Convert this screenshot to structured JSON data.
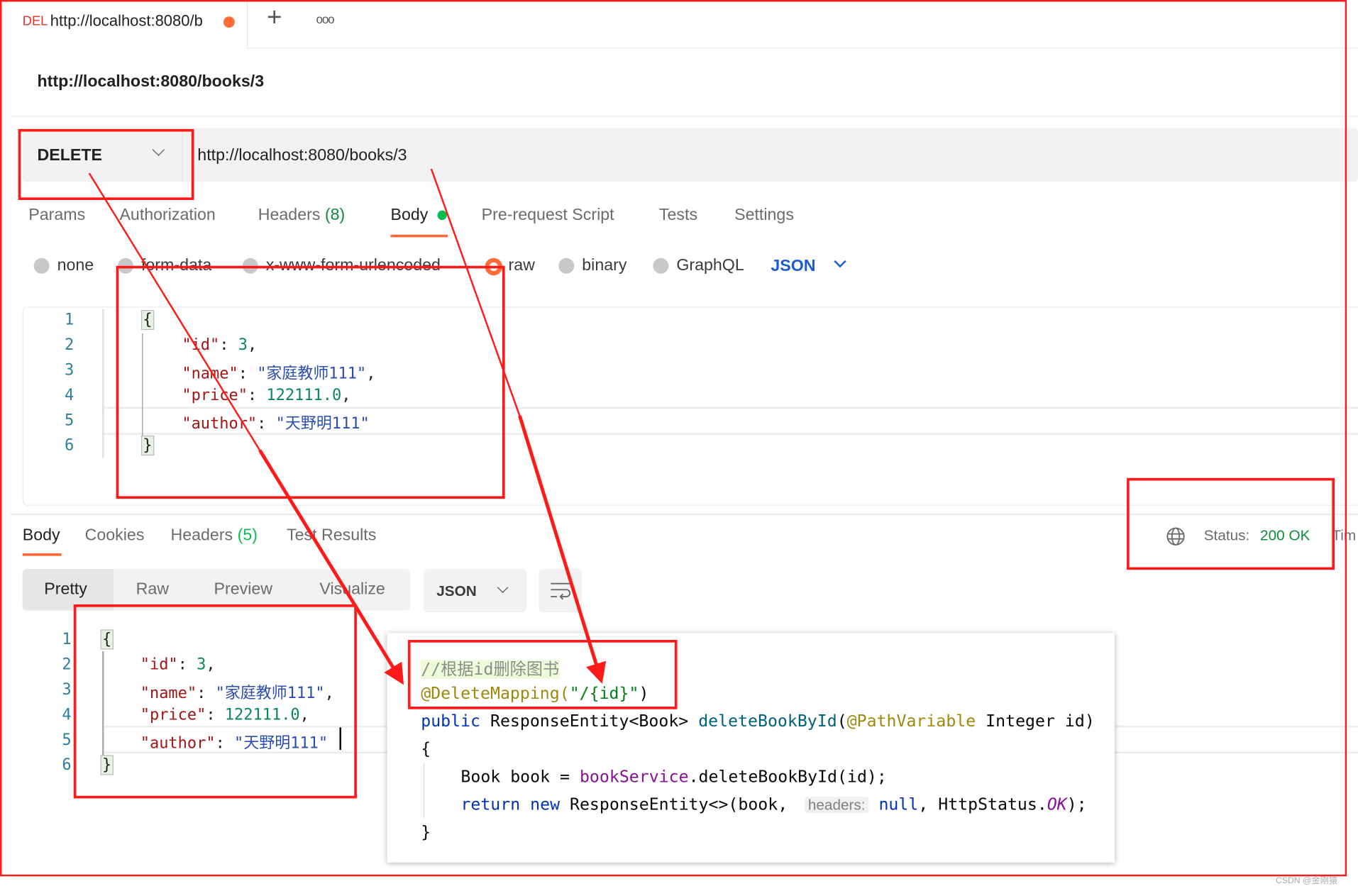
{
  "tab": {
    "method_badge": "DEL",
    "title": "http://localhost:8080/b",
    "unsaved_color": "#ff6c37",
    "new_tab": "+",
    "more": "ooo"
  },
  "request": {
    "name": "http://localhost:8080/books/3",
    "method": "DELETE",
    "url": "http://localhost:8080/books/3",
    "tabs": [
      {
        "label": "Params"
      },
      {
        "label": "Authorization"
      },
      {
        "label": "Headers",
        "count": "(8)"
      },
      {
        "label": "Body",
        "active": true
      },
      {
        "label": "Pre-request Script"
      },
      {
        "label": "Tests"
      },
      {
        "label": "Settings"
      }
    ],
    "body_types": [
      "none",
      "form-data",
      "x-www-form-urlencoded",
      "raw",
      "binary",
      "GraphQL"
    ],
    "selected_body_type": "raw",
    "format": "JSON",
    "body_lines": [
      {
        "num": "1",
        "tokens": [
          {
            "t": "{",
            "c": "p"
          }
        ]
      },
      {
        "num": "2",
        "tokens": [
          {
            "t": "\"id\"",
            "c": "k"
          },
          {
            "t": ": ",
            "c": "p"
          },
          {
            "t": "3",
            "c": "n"
          },
          {
            "t": ",",
            "c": "p"
          }
        ]
      },
      {
        "num": "3",
        "tokens": [
          {
            "t": "\"name\"",
            "c": "k"
          },
          {
            "t": ": ",
            "c": "p"
          },
          {
            "t": "\"家庭教师111\"",
            "c": "s"
          },
          {
            "t": ",",
            "c": "p"
          }
        ]
      },
      {
        "num": "4",
        "tokens": [
          {
            "t": "\"price\"",
            "c": "k"
          },
          {
            "t": ": ",
            "c": "p"
          },
          {
            "t": "122111.0",
            "c": "n"
          },
          {
            "t": ",",
            "c": "p"
          }
        ]
      },
      {
        "num": "5",
        "tokens": [
          {
            "t": "\"author\"",
            "c": "k"
          },
          {
            "t": ": ",
            "c": "p"
          },
          {
            "t": "\"天野明111\"",
            "c": "s"
          }
        ]
      },
      {
        "num": "6",
        "tokens": [
          {
            "t": "}",
            "c": "p"
          }
        ]
      }
    ]
  },
  "response": {
    "tabs": [
      {
        "label": "Body",
        "active": true
      },
      {
        "label": "Cookies"
      },
      {
        "label": "Headers",
        "count": "(5)"
      },
      {
        "label": "Test Results"
      }
    ],
    "status_label": "Status:",
    "status_value": "200 OK",
    "time_label": "Tim",
    "views": [
      "Pretty",
      "Raw",
      "Preview",
      "Visualize"
    ],
    "active_view": "Pretty",
    "format": "JSON"
  },
  "code_popup": {
    "lines": [
      [
        {
          "t": "//根据id删除图书",
          "c": "#8c8c8c",
          "bg": "#edfcd8"
        }
      ],
      [
        {
          "t": "@DeleteMapping(",
          "c": "#9e880d"
        },
        {
          "t": "\"/{id}\"",
          "c": "#067d17"
        },
        {
          "t": ")",
          "c": "#080808"
        }
      ],
      [
        {
          "t": "public ",
          "c": "#0033b3"
        },
        {
          "t": "ResponseEntity<Book> ",
          "c": "#080808"
        },
        {
          "t": "deleteBookById",
          "c": "#00627a"
        },
        {
          "t": "(",
          "c": "#080808"
        },
        {
          "t": "@PathVariable ",
          "c": "#9e880d"
        },
        {
          "t": "Integer id)",
          "c": "#080808"
        }
      ],
      [
        {
          "t": "{",
          "c": "#080808"
        }
      ],
      [
        {
          "t": "Book book = ",
          "c": "#080808"
        },
        {
          "t": "bookService",
          "c": "#871094"
        },
        {
          "t": ".deleteBookById(id);",
          "c": "#080808"
        }
      ],
      [
        {
          "t": "return ",
          "c": "#0033b3"
        },
        {
          "t": "new ",
          "c": "#0033b3"
        },
        {
          "t": "ResponseEntity<>(book, ",
          "c": "#080808"
        },
        {
          "t": "headers:",
          "c": "#808080",
          "hint": true
        },
        {
          "t": " null",
          "c": "#0033b3"
        },
        {
          "t": ", HttpStatus.",
          "c": "#080808"
        },
        {
          "t": "OK",
          "c": "#871094",
          "italic": true
        },
        {
          "t": ");",
          "c": "#080808"
        }
      ],
      [
        {
          "t": "}",
          "c": "#080808"
        }
      ]
    ]
  },
  "watermark": "CSDN @金刚猿",
  "colors": {
    "annotation_red": "#ff1a1a",
    "accent_orange": "#ff6c37",
    "success_green": "#0f8a3c",
    "json_blue": "#1d5bd6"
  }
}
